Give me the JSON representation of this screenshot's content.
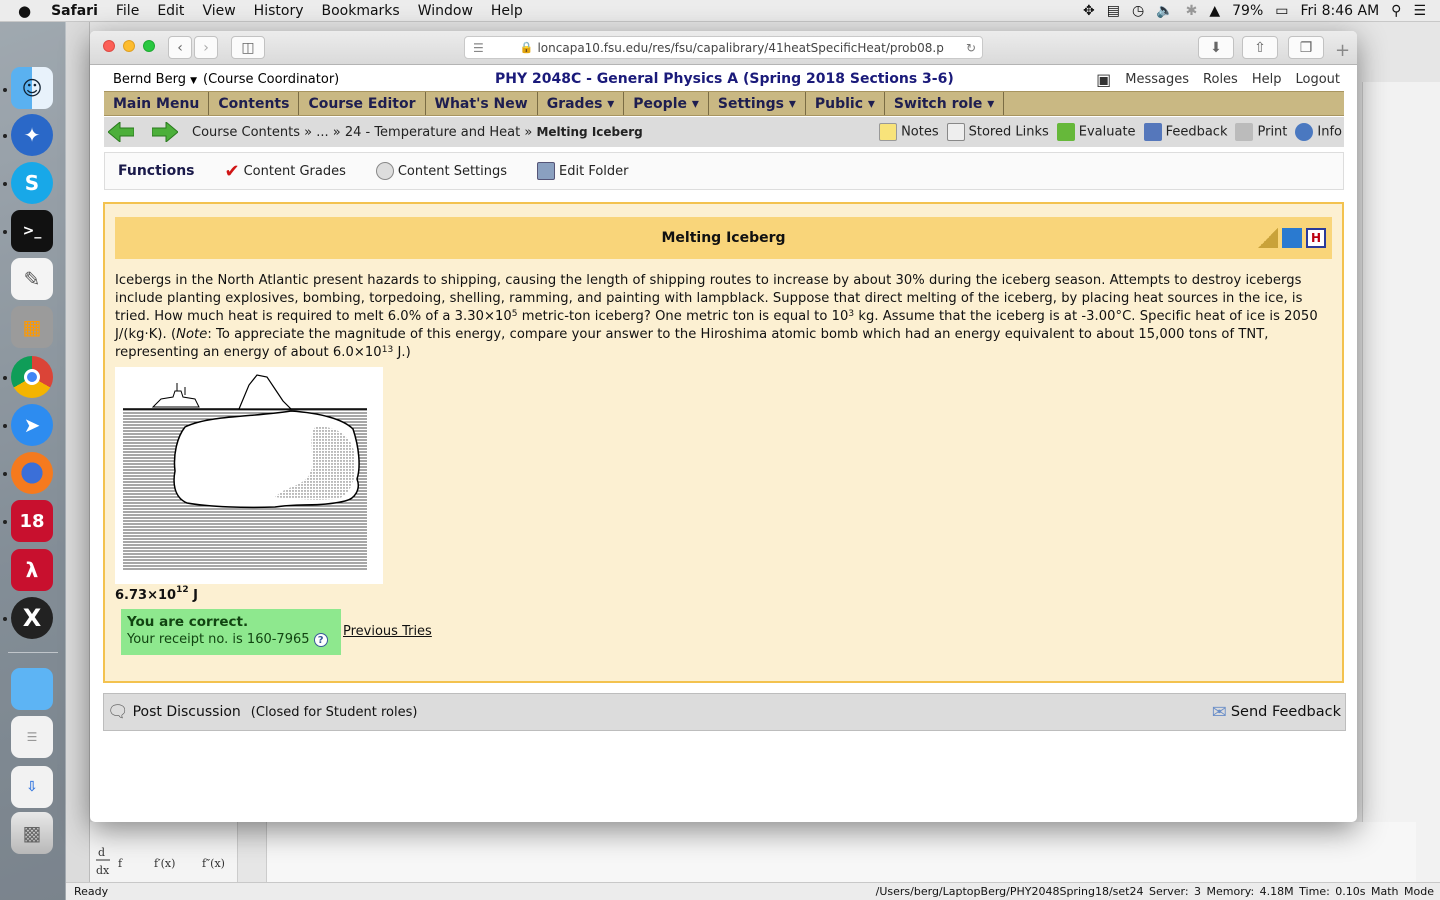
{
  "menubar": {
    "apple": "",
    "app": "Safari",
    "items": [
      "File",
      "Edit",
      "View",
      "History",
      "Bookmarks",
      "Window",
      "Help"
    ],
    "battery": "79%",
    "clock": "Fri 8:46 AM"
  },
  "browser": {
    "url": "loncapa10.fsu.edu/res/fsu/capalibrary/41heatSpecificHeat/prob08.p"
  },
  "lc_header": {
    "user": "Bernd Berg",
    "role": "(Course Coordinator)",
    "course": "PHY 2048C - General Physics A (Spring 2018 Sections 3-6)",
    "links": [
      "Messages",
      "Roles",
      "Help",
      "Logout"
    ]
  },
  "nav_menu": [
    "Main Menu",
    "Contents",
    "Course Editor",
    "What's New",
    "Grades ▾",
    "People ▾",
    "Settings ▾",
    "Public ▾",
    "Switch role ▾"
  ],
  "breadcrumb": {
    "part1": "Course Contents » ... » 24 - Temperature and Heat »",
    "current": "Melting Iceberg"
  },
  "tools": [
    "Notes",
    "Stored Links",
    "Evaluate",
    "Feedback",
    "Print",
    "Info"
  ],
  "functions": {
    "title": "Functions",
    "items": [
      "Content Grades",
      "Content Settings",
      "Edit Folder"
    ]
  },
  "problem": {
    "title": "Melting Iceberg",
    "p1": "Icebergs in the North Atlantic present hazards to shipping, causing the length of shipping routes to increase by about 30% during the iceberg season. Attempts to destroy icebergs include planting explosives, bombing, torpedoing, shelling, ramming, and painting with lampblack. Suppose that direct melting of the iceberg, by placing heat sources in the ice, is tried.",
    "p2a": "How much heat is required to melt 6.0% of a 3.30×10",
    "p2b": "5",
    "p2c": " metric-ton iceberg? One metric ton is equal to 10",
    "p2d": "3",
    "p2e": " kg. Assume that the iceberg is at -3.00°C. Specific heat of ice is 2050 J/(kg·K). (",
    "note": "Note",
    "p2f": ": To appreciate the magnitude of this energy, compare your answer to the Hiroshima atomic bomb which had an energy equivalent to about 15,000 tons of TNT, representing an energy of about 6.0×10",
    "p2g": "13",
    "p2h": " J.)",
    "answer_mantissa": "6.73×10",
    "answer_exp": "12",
    "answer_unit": " J",
    "correct": "You are correct.",
    "receipt": "Your receipt no. is 160-7965",
    "previous": "Previous Tries"
  },
  "discussion": {
    "post": "Post Discussion",
    "note": "(Closed for Student roles)",
    "send": "Send Feedback"
  },
  "status": {
    "left": "Ready",
    "right": "/Users/berg/LaptopBerg/PHY2048Spring18/set24   Server: 3   Memory: 4.18M   Time: 0.10s   Math Mode"
  }
}
